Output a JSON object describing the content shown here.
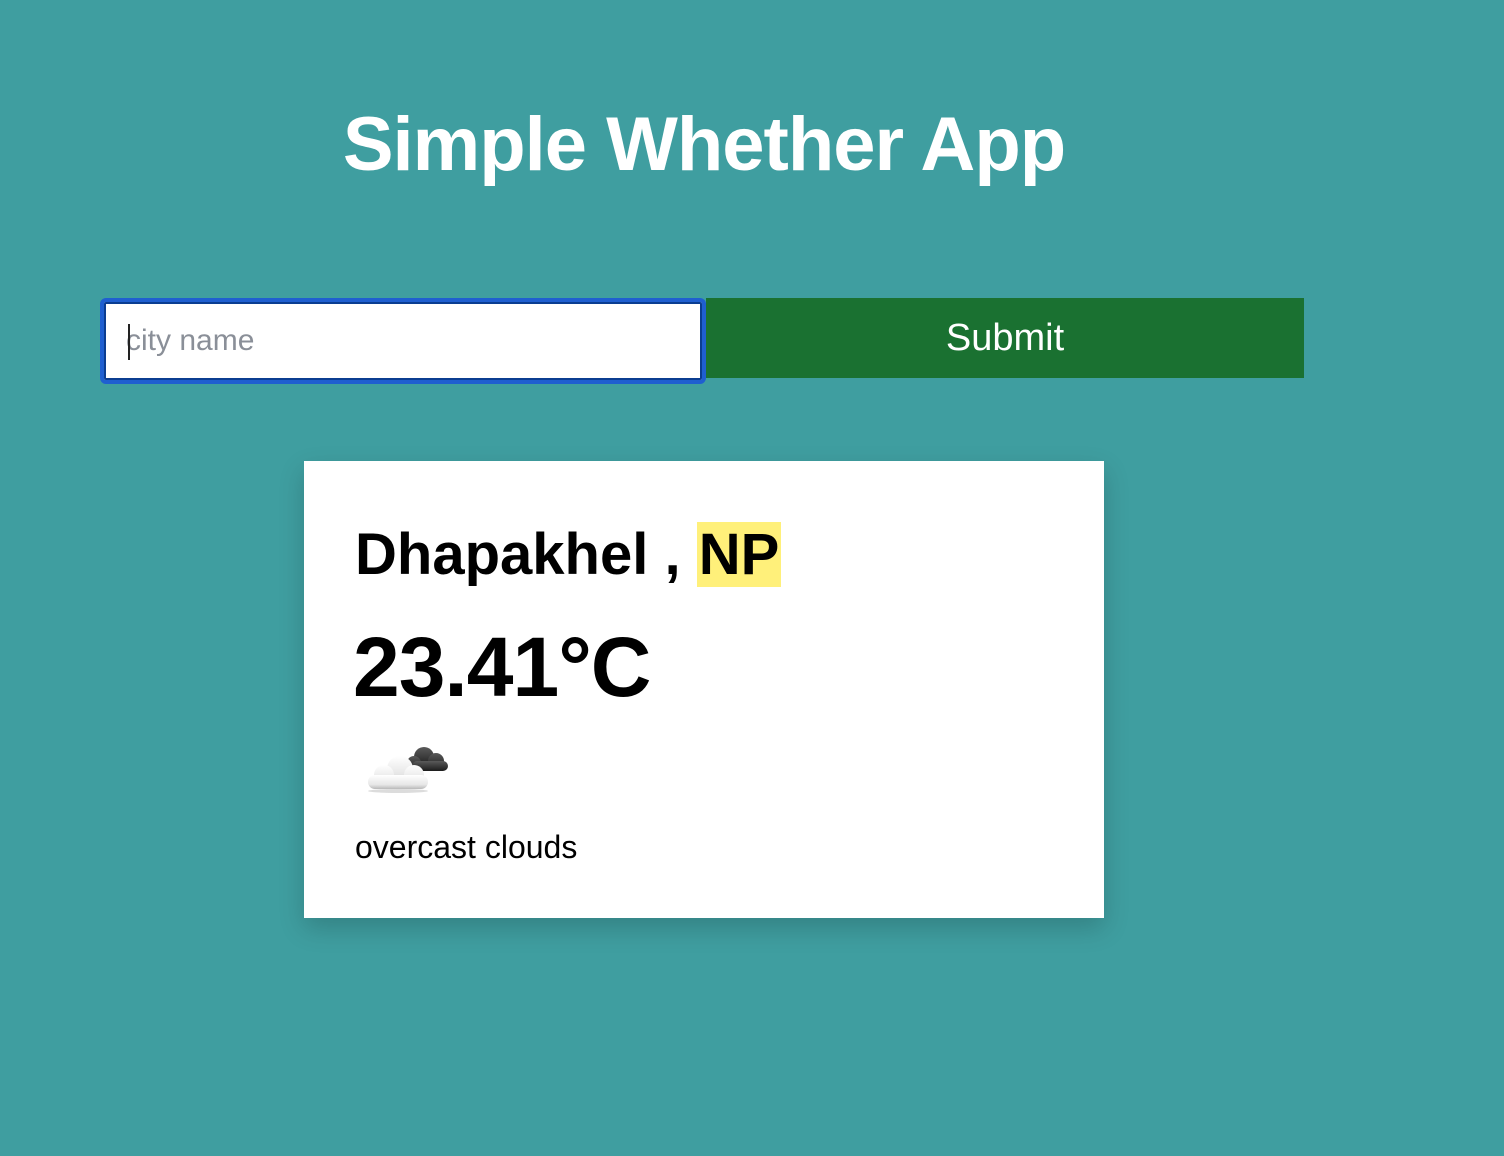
{
  "header": {
    "title": "Simple Whether App"
  },
  "search": {
    "placeholder": "city name",
    "value": "",
    "submit_label": "Submit"
  },
  "weather": {
    "city": "Dhapakhel",
    "separator": ",",
    "country": "NP",
    "temperature": "23.41°C",
    "icon": "overcast-clouds-icon",
    "description": "overcast clouds"
  },
  "colors": {
    "background": "#3f9ea0",
    "submit_button": "#1a7131",
    "input_focus_border": "#1f5fd0",
    "country_highlight": "#fff07a",
    "card": "#ffffff"
  }
}
